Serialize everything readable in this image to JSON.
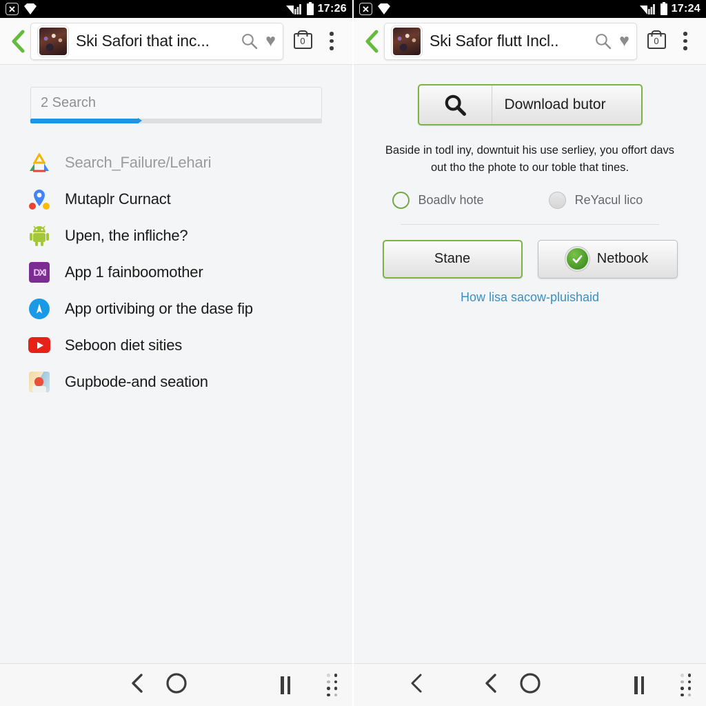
{
  "left": {
    "status": {
      "time": "17:26",
      "icons": [
        "x-badge-icon",
        "diamond-icon",
        "signal-icon",
        "battery-icon"
      ]
    },
    "header": {
      "back": "‹",
      "title": "Ski Safori that inc...",
      "search_icon": "search-icon",
      "favorite_icon": "heart-icon",
      "bag_count": "0",
      "overflow_icon": "kebab-menu-icon"
    },
    "search": {
      "value": "2 Search",
      "placeholder": "Search",
      "progress_percent": 37
    },
    "apps": [
      {
        "label": "Search_Failure/Lehari",
        "icon": "adsense-icon",
        "muted": true
      },
      {
        "label": "Mutaplr Curnact",
        "icon": "maps-pin-icon",
        "muted": false
      },
      {
        "label": "Upen, the infliche?",
        "icon": "android-icon",
        "muted": false
      },
      {
        "label": "App 1 fainboomother",
        "icon": "purple-app-icon",
        "muted": false
      },
      {
        "label": "App ortivibing or the dase fip",
        "icon": "blue-circle-app-icon",
        "muted": false
      },
      {
        "label": "Seboon diet sities",
        "icon": "youtube-icon",
        "muted": false
      },
      {
        "label": "Gupbode-and seation",
        "icon": "photos-icon",
        "muted": false
      }
    ],
    "nav": {
      "back": "‹",
      "home": "home-circle-icon",
      "pause": "pause-icon",
      "grid": "recents-grid-icon"
    }
  },
  "right": {
    "status": {
      "time": "17:24"
    },
    "header": {
      "back": "‹",
      "title": "Ski Safor flutt Incl..",
      "search_icon": "search-icon",
      "favorite_icon": "heart-icon",
      "bag_count": "0",
      "overflow_icon": "kebab-menu-icon"
    },
    "download_button": {
      "icon": "search-magnifier-icon",
      "label": "Download butor"
    },
    "blurb": "Baside in todl iny, downtuit his use serliey, you offort davs out tho the phote to our toble that tines.",
    "radios": [
      {
        "label": "Boadlv hote",
        "selected": true
      },
      {
        "label": "ReYacul lico",
        "selected": false
      }
    ],
    "actions": [
      {
        "label": "Stane",
        "style": "primary",
        "icon": null
      },
      {
        "label": "Netbook",
        "style": "secondary",
        "icon": "green-check-icon"
      }
    ],
    "link": "How lisa sacow-pluishaid",
    "nav": {
      "extra_back": "‹",
      "back": "‹",
      "home": "home-circle-icon",
      "pause": "pause-icon",
      "grid": "recents-grid-icon"
    }
  },
  "colors": {
    "accent_green": "#7cb342",
    "progress_blue": "#1f94e0",
    "link_blue": "#3a8fc4",
    "panel_bg": "#f4f5f6",
    "statusbar_bg": "#000000"
  }
}
